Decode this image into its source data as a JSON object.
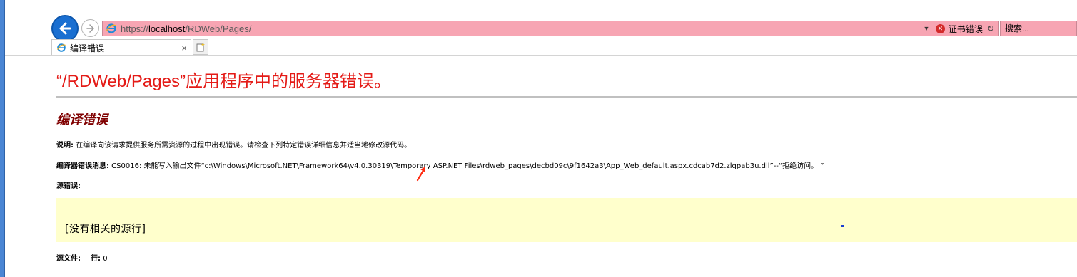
{
  "browser": {
    "url_scheme": "https://",
    "url_host": "localhost",
    "url_path": "/RDWeb/Pages/",
    "cert_error_label": "证书错误",
    "search_placeholder": "搜索...",
    "address_bar_color": "#f7a5b3",
    "tab": {
      "label": "编译错误",
      "icon": "ie-icon",
      "close": "×"
    },
    "new_tab_icon": "new-tab-icon"
  },
  "page": {
    "title": "“/RDWeb/Pages”应用程序中的服务器错误。",
    "title_color": "#e41b17",
    "section_title": "编译错误",
    "section_title_color": "#800000",
    "description_label": "说明:",
    "description_text": " 在编译向该请求提供服务所需资源的过程中出现错误。请检查下列特定错误详细信息并适当地修改源代码。",
    "compile_error_label": "编译器错误消息:",
    "compile_error_text": " CS0016: 未能写入输出文件“c:\\Windows\\Microsoft.NET\\Framework64\\v4.0.30319\\Temporary ASP.NET Files\\rdweb_pages\\decbd09c\\9f1642a3\\App_Web_default.aspx.cdcab7d2.zlqpab3u.dll”--“拒绝访问。 ”",
    "source_error_label": "源错误:",
    "source_code": "[没有相关的源行]",
    "source_bg_color": "#ffffcc",
    "source_file_label": "源文件:",
    "line_label": "行:",
    "line_value": "0"
  }
}
